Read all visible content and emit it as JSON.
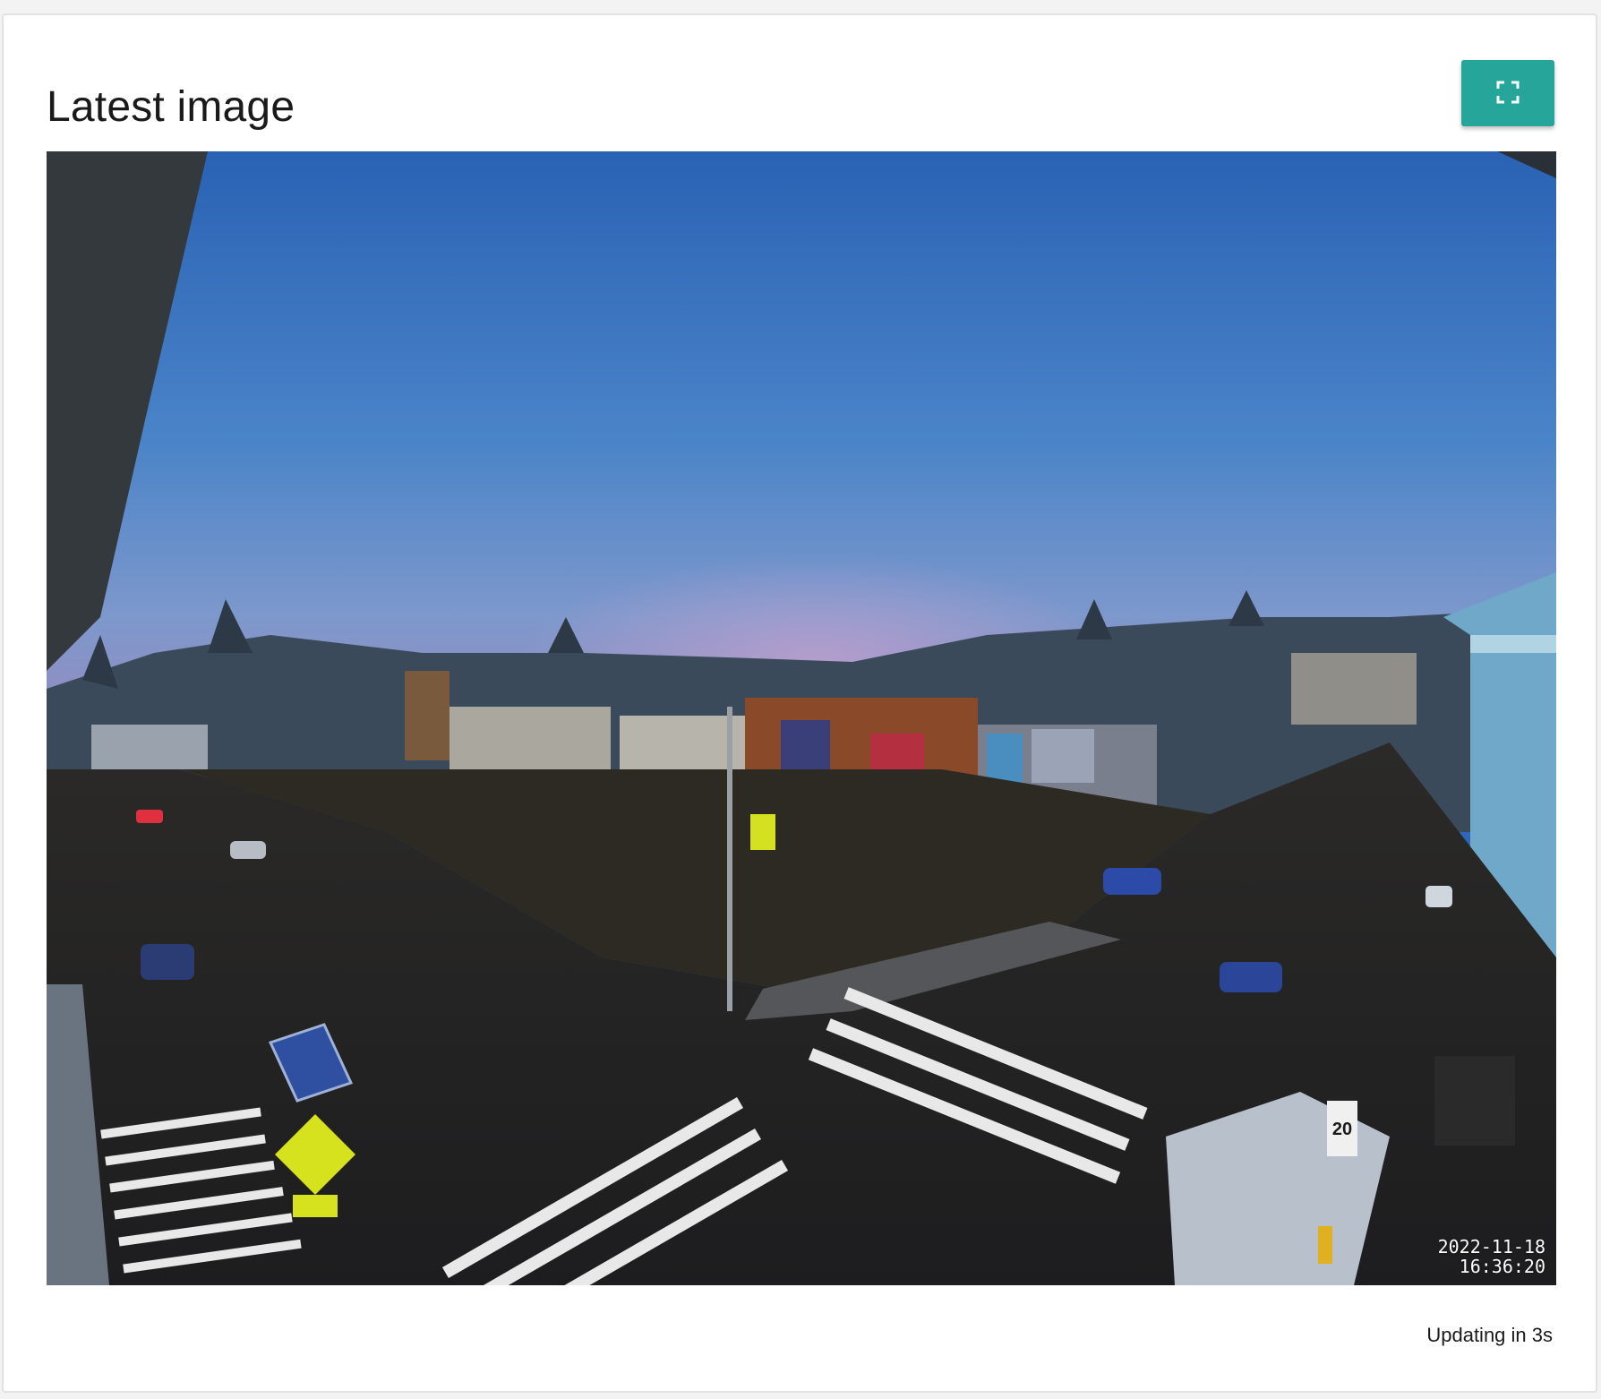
{
  "card": {
    "title": "Latest image",
    "fullscreen_icon": "fullscreen-icon",
    "accent_color": "#26a69a"
  },
  "image": {
    "timestamp_date": "2022-11-18",
    "timestamp_time": "16:36:20",
    "sign_speed_limit": "20"
  },
  "status": {
    "updating_text": "Updating in 3s"
  }
}
